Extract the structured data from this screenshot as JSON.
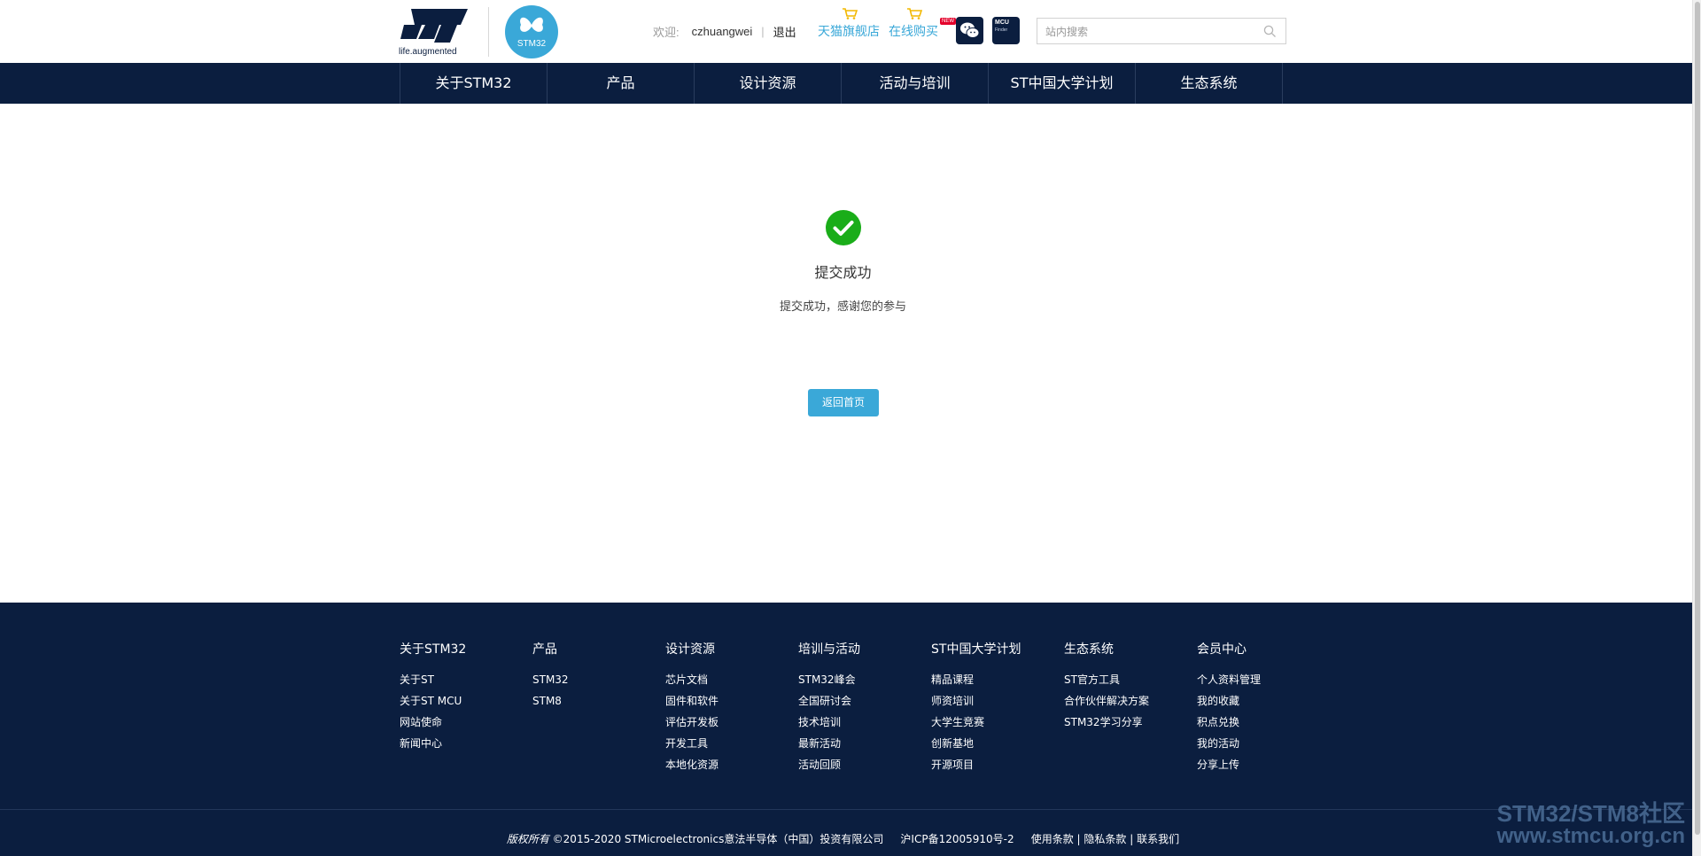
{
  "header": {
    "logo_tagline": "life.augmented",
    "stm32_badge": "STM32",
    "welcome": "欢迎:",
    "username": "czhuangwei",
    "separator": "|",
    "logout": "退出",
    "tmall_store": "天猫旗舰店",
    "online_buy": "在线购买",
    "new_badge": "NEW",
    "mcu_title": "MCU",
    "mcu_sub": "Finder",
    "search_placeholder": "站内搜索"
  },
  "nav": [
    {
      "label": "关于STM32"
    },
    {
      "label": "产品"
    },
    {
      "label": "设计资源"
    },
    {
      "label": "活动与培训"
    },
    {
      "label": "ST中国大学计划"
    },
    {
      "label": "生态系统"
    }
  ],
  "main": {
    "title": "提交成功",
    "message": "提交成功，感谢您的参与",
    "home_button": "返回首页"
  },
  "footer": {
    "columns": [
      {
        "title": "关于STM32",
        "links": [
          "关于ST",
          "关于ST MCU",
          "网站使命",
          "新闻中心"
        ]
      },
      {
        "title": "产品",
        "links": [
          "STM32",
          "STM8"
        ]
      },
      {
        "title": "设计资源",
        "links": [
          "芯片文档",
          "固件和软件",
          "评估开发板",
          "开发工具",
          "本地化资源"
        ]
      },
      {
        "title": "培训与活动",
        "links": [
          "STM32峰会",
          "全国研讨会",
          "技术培训",
          "最新活动",
          "活动回顾"
        ]
      },
      {
        "title": "ST中国大学计划",
        "links": [
          "精品课程",
          "师资培训",
          "大学生竞赛",
          "创新基地",
          "开源项目"
        ]
      },
      {
        "title": "生态系统",
        "links": [
          "ST官方工具",
          "合作伙伴解决方案",
          "STM32学习分享"
        ]
      },
      {
        "title": "会员中心",
        "links": [
          "个人资料管理",
          "我的收藏",
          "积点兑换",
          "我的活动",
          "分享上传"
        ]
      }
    ],
    "copyright_prefix": "版权所有",
    "copyright_text": "©2015-2020 STMicroelectronics意法半导体（中国）投资有限公司",
    "icp": "沪ICP备12005910号-2",
    "terms": "使用条款",
    "privacy": "隐私条款",
    "contact": "联系我们",
    "pipe": "|",
    "watermark_line1": "STM32/STM8社区",
    "watermark_line2": "www.stmcu.org.cn"
  },
  "colors": {
    "navy": "#0b1e3f",
    "accent_blue": "#3aa8d8",
    "success_green": "#1aad19"
  },
  "icons": [
    "cart-icon",
    "wechat-icon",
    "search-icon",
    "check-circle-icon"
  ]
}
